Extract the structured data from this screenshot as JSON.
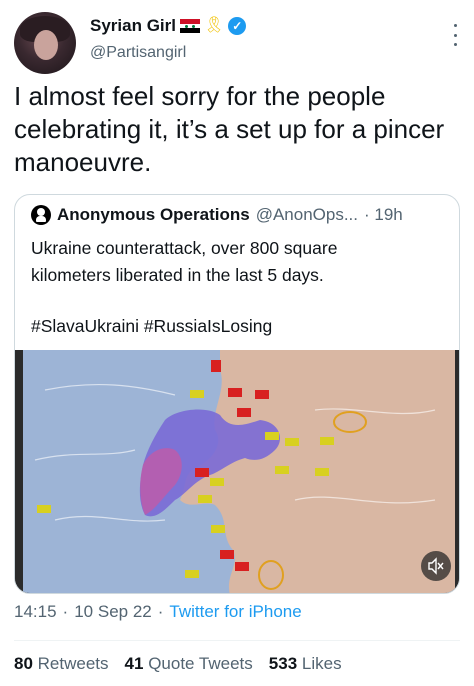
{
  "author": {
    "display_name": "Syrian Girl",
    "handle": "@Partisangirl",
    "ribbon_icon": "yellow-ribbon-icon",
    "flag_icon": "syria-flag-icon",
    "verified_icon": "verified-badge-icon"
  },
  "tweet": {
    "text": "I almost feel sorry for the people celebrating it, it’s a set up for a pincer manoeuvre."
  },
  "quoted_tweet": {
    "name": "Anonymous Operations",
    "handle": "@AnonOps...",
    "time": "· 19h",
    "text_line1": "Ukraine counterattack, over 800 square",
    "text_line2": "kilometers liberated in the last 5 days.",
    "hashtags": "#SlavaUkraini #RussiaIsLosing",
    "media_type": "video",
    "mute_icon": "muted-speaker-icon"
  },
  "meta": {
    "time": "14:15",
    "sep1": "·",
    "date": "10 Sep 22",
    "sep2": "·",
    "source": "Twitter for iPhone"
  },
  "stats": {
    "retweets_count": "80",
    "retweets_label": "Retweets",
    "quotes_count": "41",
    "quotes_label": "Quote Tweets",
    "likes_count": "533",
    "likes_label": "Likes"
  },
  "colors": {
    "link": "#1d9bf0",
    "secondary_text": "#536471",
    "border": "#cfd9de"
  }
}
